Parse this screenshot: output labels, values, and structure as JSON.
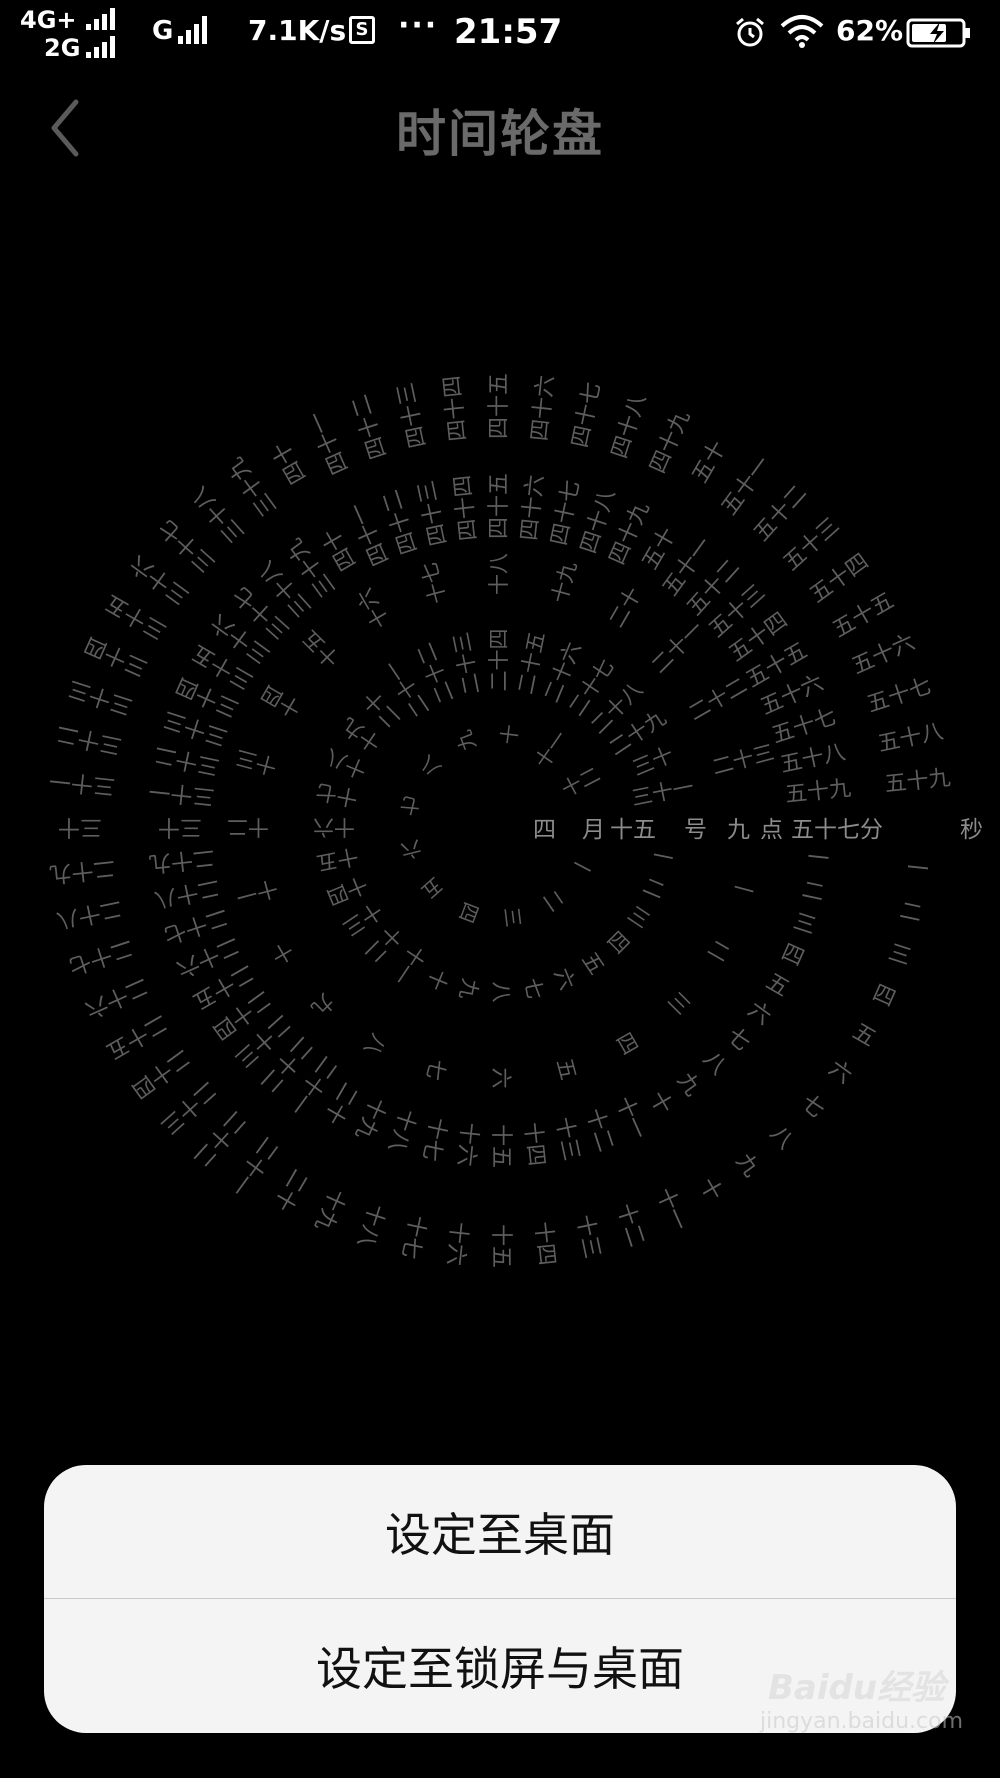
{
  "status_bar": {
    "network_primary": "4G+",
    "network_secondary": "2G",
    "network_tertiary": "G",
    "speed": "7.1K/s",
    "s_badge": "S",
    "more": "···",
    "time": "21:57",
    "battery_percent": "62%",
    "icons": [
      "signal-icon",
      "alarm-icon",
      "wifi-icon",
      "battery-charging-icon"
    ]
  },
  "header": {
    "title": "时间轮盘",
    "back_icon": "chevron-left-icon"
  },
  "dial": {
    "colors": {
      "ring_text": "#5e5e5e",
      "highlight_text": "#8c8c8c"
    },
    "rings": {
      "seconds": [
        "一",
        "二",
        "三",
        "四",
        "五",
        "六",
        "七",
        "八",
        "九",
        "十",
        "十一",
        "十二",
        "十三",
        "十四",
        "十五",
        "十六",
        "十七",
        "十八",
        "十九",
        "二十",
        "二十一",
        "二十二",
        "二十三",
        "二十四",
        "二十五",
        "二十六",
        "二十七",
        "二十八",
        "二十九",
        "三十",
        "三十一",
        "三十二",
        "三十三",
        "三十四",
        "三十五",
        "三十六",
        "三十七",
        "三十八",
        "三十九",
        "四十",
        "四十一",
        "四十二",
        "四十三",
        "四十四",
        "四十五",
        "四十六",
        "四十七",
        "四十八",
        "四十九",
        "五十",
        "五十一",
        "五十二",
        "五十三",
        "五十四",
        "五十五",
        "五十六",
        "五十七",
        "五十八",
        "五十九"
      ],
      "minutes": [
        "一",
        "二",
        "三",
        "四",
        "五",
        "六",
        "七",
        "八",
        "九",
        "十",
        "十一",
        "十二",
        "十三",
        "十四",
        "十五",
        "十六",
        "十七",
        "十八",
        "十九",
        "二十",
        "二十一",
        "二十二",
        "二十三",
        "二十四",
        "二十五",
        "二十六",
        "二十七",
        "二十八",
        "二十九",
        "三十",
        "三十一",
        "三十二",
        "三十三",
        "三十四",
        "三十五",
        "三十六",
        "三十七",
        "三十八",
        "三十九",
        "四十",
        "四十一",
        "四十二",
        "四十三",
        "四十四",
        "四十五",
        "四十六",
        "四十七",
        "四十八",
        "四十九",
        "五十",
        "五十一",
        "五十二",
        "五十三",
        "五十四",
        "五十五",
        "五十六",
        "五十七",
        "五十八",
        "五十九"
      ],
      "hours": [
        "一",
        "二",
        "三",
        "四",
        "五",
        "六",
        "七",
        "八",
        "九",
        "十",
        "十一",
        "十二",
        "十三",
        "十四",
        "十五",
        "十六",
        "十七",
        "十八",
        "十九",
        "二十",
        "二十一",
        "二十二",
        "二十三"
      ],
      "days": [
        "一",
        "二",
        "三",
        "四",
        "五",
        "六",
        "七",
        "八",
        "九",
        "十",
        "十一",
        "十二",
        "十三",
        "十四",
        "十五",
        "十六",
        "十七",
        "十八",
        "十九",
        "二十",
        "二十一",
        "二十二",
        "二十三",
        "二十四",
        "二十五",
        "二十六",
        "二十七",
        "二十八",
        "二十九",
        "三十",
        "三十一"
      ],
      "months": [
        "一",
        "二",
        "三",
        "四",
        "五",
        "六",
        "七",
        "八",
        "九",
        "十",
        "十一",
        "十二"
      ]
    },
    "current": {
      "month": "四",
      "month_unit": "月",
      "day": "十五",
      "day_unit": "号",
      "hour": "九",
      "hour_unit": "点",
      "minute": "五十七",
      "minute_unit": "分",
      "second_unit": "秒"
    }
  },
  "sheet": {
    "option_desktop": "设定至桌面",
    "option_lock_and_desktop": "设定至锁屏与桌面"
  },
  "watermark": {
    "brand": "Baidu经验",
    "url": "jingyan.baidu.com"
  }
}
